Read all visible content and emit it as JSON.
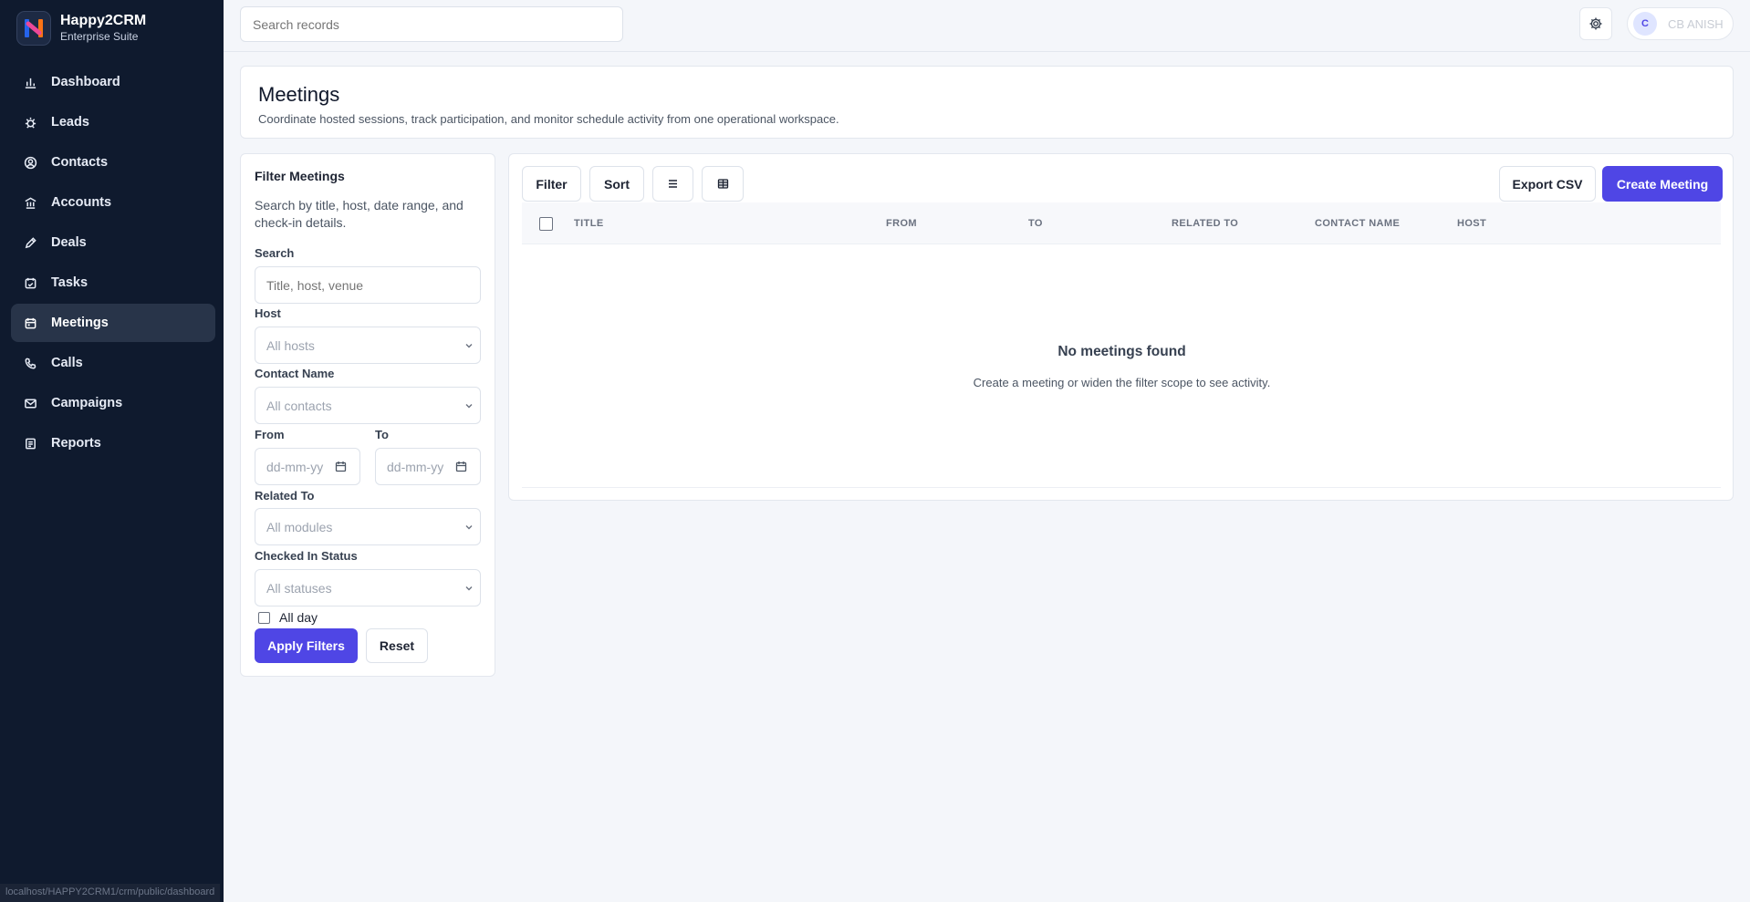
{
  "brand": {
    "title": "Happy2CRM",
    "subtitle": "Enterprise Suite"
  },
  "sidebar": {
    "items": [
      {
        "label": "Dashboard",
        "icon": "bar-chart-icon",
        "active": false
      },
      {
        "label": "Leads",
        "icon": "bug-icon",
        "active": false
      },
      {
        "label": "Contacts",
        "icon": "user-circle-icon",
        "active": false
      },
      {
        "label": "Accounts",
        "icon": "bank-icon",
        "active": false
      },
      {
        "label": "Deals",
        "icon": "pen-icon",
        "active": false
      },
      {
        "label": "Tasks",
        "icon": "calendar-check-icon",
        "active": false
      },
      {
        "label": "Meetings",
        "icon": "calendar-icon",
        "active": true
      },
      {
        "label": "Calls",
        "icon": "phone-icon",
        "active": false
      },
      {
        "label": "Campaigns",
        "icon": "mail-icon",
        "active": false
      },
      {
        "label": "Reports",
        "icon": "report-icon",
        "active": false
      }
    ],
    "status_url": "localhost/HAPPY2CRM1/crm/public/dashboard"
  },
  "topbar": {
    "search_placeholder": "Search records",
    "user_initial": "C",
    "user_name": "CB ANISH"
  },
  "page": {
    "title": "Meetings",
    "description": "Coordinate hosted sessions, track participation, and monitor schedule activity from one operational workspace."
  },
  "filters": {
    "title": "Filter Meetings",
    "description": "Search by title, host, date range, and check-in details.",
    "search_label": "Search",
    "search_placeholder": "Title, host, venue",
    "host_label": "Host",
    "host_value": "All hosts",
    "contact_label": "Contact Name",
    "contact_value": "All contacts",
    "from_label": "From",
    "to_label": "To",
    "date_placeholder": "dd-mm-yy",
    "related_label": "Related To",
    "related_value": "All modules",
    "checkin_label": "Checked In Status",
    "checkin_value": "All statuses",
    "allday_label": "All day",
    "apply_label": "Apply Filters",
    "reset_label": "Reset"
  },
  "toolbar": {
    "filter_label": "Filter",
    "sort_label": "Sort",
    "export_label": "Export CSV",
    "create_label": "Create Meeting"
  },
  "table": {
    "columns": [
      "TITLE",
      "FROM",
      "TO",
      "RELATED TO",
      "CONTACT NAME",
      "HOST"
    ]
  },
  "empty": {
    "title": "No meetings found",
    "description": "Create a meeting or widen the filter scope to see activity."
  },
  "colors": {
    "sidebar_bg": "#0f1a2e",
    "primary": "#4f46e5",
    "page_bg": "#f4f6fa"
  }
}
